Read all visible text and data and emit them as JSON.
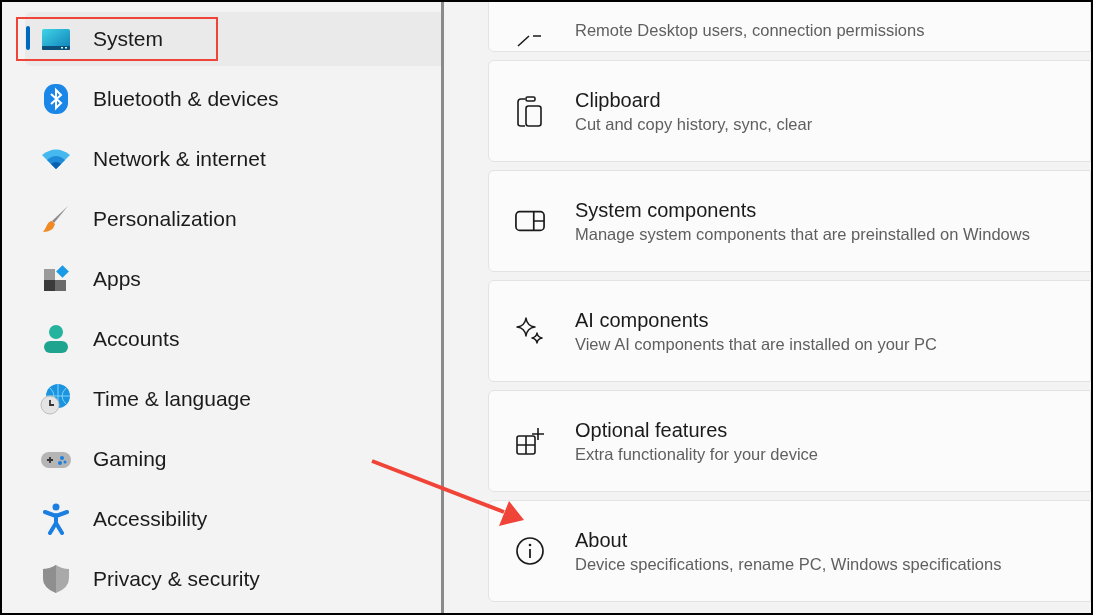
{
  "sidebar": {
    "items": [
      {
        "label": "System",
        "selected": true
      },
      {
        "label": "Bluetooth & devices",
        "selected": false
      },
      {
        "label": "Network & internet",
        "selected": false
      },
      {
        "label": "Personalization",
        "selected": false
      },
      {
        "label": "Apps",
        "selected": false
      },
      {
        "label": "Accounts",
        "selected": false
      },
      {
        "label": "Time & language",
        "selected": false
      },
      {
        "label": "Gaming",
        "selected": false
      },
      {
        "label": "Accessibility",
        "selected": false
      },
      {
        "label": "Privacy & security",
        "selected": false
      }
    ]
  },
  "settings_cards": [
    {
      "description": "Remote Desktop users, connection permissions"
    },
    {
      "title": "Clipboard",
      "description": "Cut and copy history, sync, clear"
    },
    {
      "title": "System components",
      "description": "Manage system components that are preinstalled on Windows"
    },
    {
      "title": "AI components",
      "description": "View AI components that are installed on your PC"
    },
    {
      "title": "Optional features",
      "description": "Extra functionality for your device"
    },
    {
      "title": "About",
      "description": "Device specifications, rename PC, Windows specifications"
    }
  ]
}
